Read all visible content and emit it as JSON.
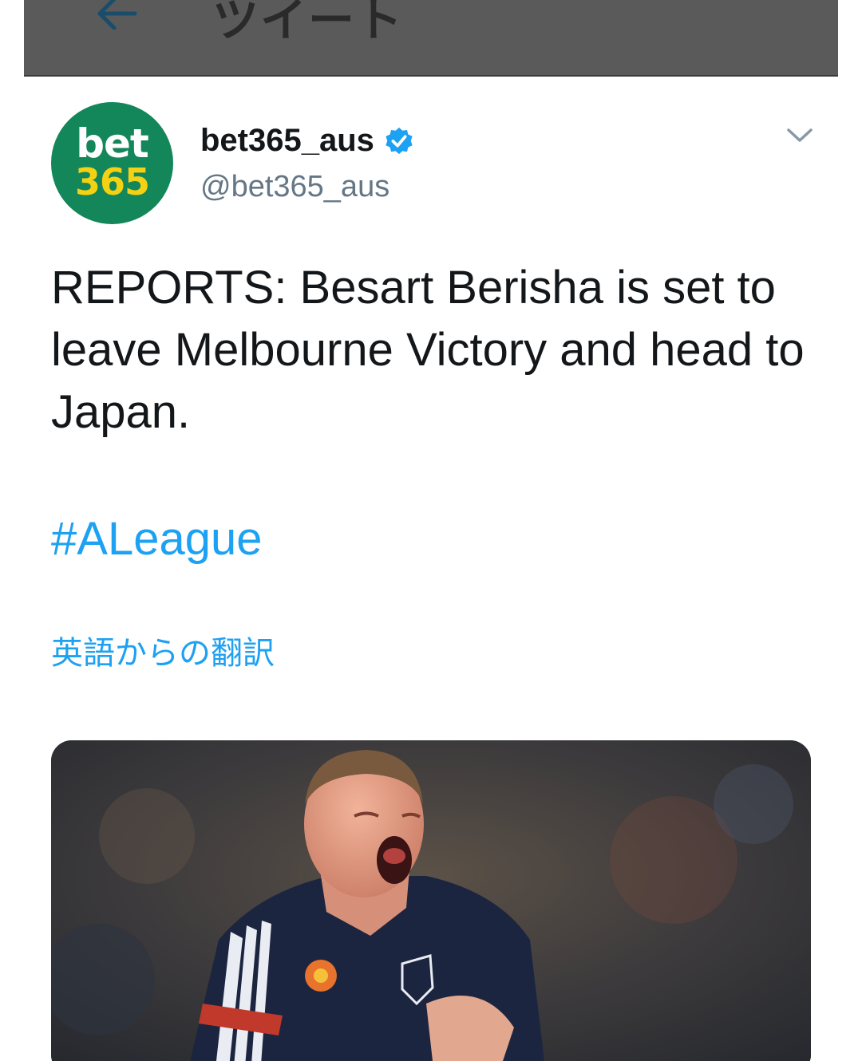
{
  "header": {
    "title": "ツイート",
    "back_icon": "arrow-left-icon"
  },
  "tweet": {
    "avatar": {
      "line1": "bet",
      "line2": "365",
      "bg_color": "#13865a",
      "accent_color": "#f5d113"
    },
    "display_name": "bet365_aus",
    "verified_icon": "verified-badge-icon",
    "handle": "@bet365_aus",
    "menu_icon": "chevron-down-icon",
    "text": "REPORTS: Besart Berisha is set to leave Melbourne Victory and head to Japan.",
    "hashtag": "#ALeague",
    "translate_label": "英語からの翻訳",
    "media": {
      "kind": "photo",
      "subject": "footballer celebrating in navy Melbourne Victory kit"
    }
  },
  "colors": {
    "link": "#1da1f2",
    "text": "#14171a",
    "muted": "#657786",
    "header_bg": "#5a5a5a"
  }
}
